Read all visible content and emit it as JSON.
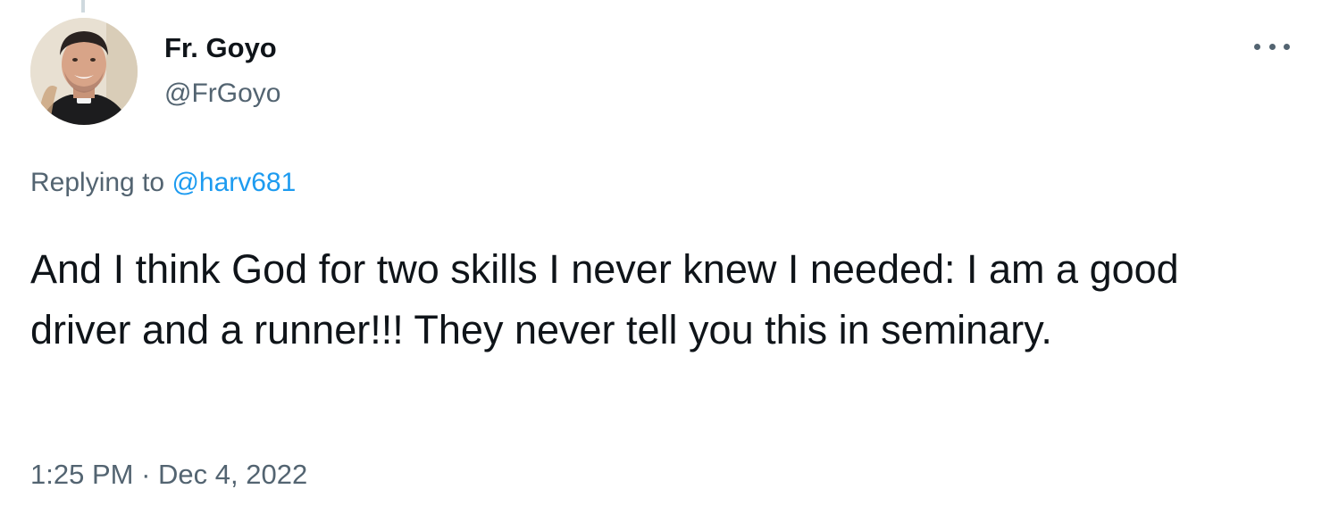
{
  "tweet": {
    "display_name": "Fr. Goyo",
    "handle": "@FrGoyo",
    "replying_prefix": "Replying to",
    "replying_to": "@harv681",
    "text": "And I think God for two skills I never knew I needed: I am a good driver and a runner!!! They never tell you this in seminary.",
    "time": "1:25 PM",
    "separator": " · ",
    "date": "Dec 4, 2022"
  },
  "icons": {
    "more": "more-options-icon",
    "avatar": "profile-avatar"
  },
  "colors": {
    "text_primary": "#0f1419",
    "text_secondary": "#536471",
    "link": "#1d9bf0",
    "thread_line": "#cfd9de"
  }
}
